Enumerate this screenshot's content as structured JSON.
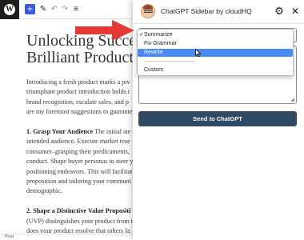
{
  "editor": {
    "toolbar": {
      "add_icon": "+",
      "pencil_icon": "✎",
      "undo_icon": "↶",
      "redo_icon": "↷",
      "list_view_icon": "≡"
    },
    "title_lines": [
      "Unlocking Success:",
      "Brilliant Product La"
    ],
    "body_lines": [
      {
        "bold": "",
        "text": "Introducing a fresh product marks a piv"
      },
      {
        "bold": "",
        "text": "triumphant product introduction holds t"
      },
      {
        "bold": "",
        "text": "brand recognition, escalate sales, and p"
      },
      {
        "bold": "",
        "text": "are my foremost suggestions to guarante"
      },
      {
        "bold": "",
        "text": ""
      },
      {
        "bold": "1. Grasp Your Audience",
        "text": " The initial ste"
      },
      {
        "bold": "",
        "text": "intended audience. Execute market rese"
      },
      {
        "bold": "",
        "text": "consumer–grasping their predicaments,"
      },
      {
        "bold": "",
        "text": "conduct. Shape buyer personas to steer y"
      },
      {
        "bold": "",
        "text": "positioning endeavors. This will facilitat"
      },
      {
        "bold": "",
        "text": "proposition and tailoring your communi"
      },
      {
        "bold": "",
        "text": "demographic."
      },
      {
        "bold": "",
        "text": ""
      },
      {
        "bold": "2. Shape a Distinctive Value Propositi",
        "text": ""
      },
      {
        "bold": "",
        "text": "(UVP) distinguishes your product from t"
      },
      {
        "bold": "",
        "text": "does your product resolve that others fa"
      }
    ],
    "footer_label": "Post"
  },
  "sidebar": {
    "title": "ChatGPT Sidebar by cloudHQ",
    "gear_icon": "⚙",
    "close_icon": "✕",
    "dropdown": {
      "selected": "Summarize",
      "items": [
        {
          "label": "Summarize",
          "checked": true
        },
        {
          "label": "Fix Grammar",
          "checked": false
        },
        {
          "label": "Rewrite",
          "checked": false
        },
        {
          "label": "Custom",
          "checked": false
        }
      ],
      "highlighted_index": 2
    },
    "send_button_label": "Send to ChatGPT"
  },
  "colors": {
    "accent_blue": "#3858e9",
    "send_button": "#2e4b63",
    "highlight": "#4a8af4",
    "annotation_red": "#e53935"
  }
}
